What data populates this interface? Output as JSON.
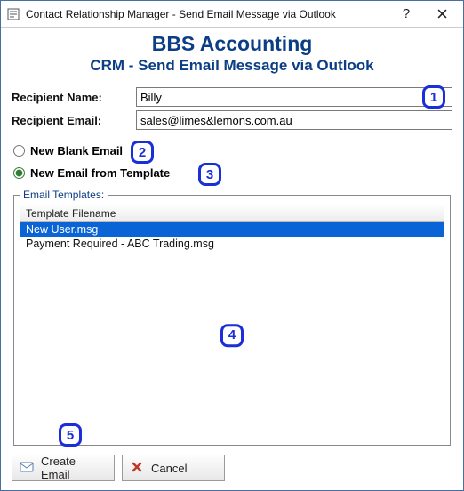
{
  "window": {
    "title": "Contact Relationship Manager - Send Email Message via Outlook"
  },
  "brand": {
    "title": "BBS Accounting",
    "subtitle": "CRM - Send Email Message via Outlook"
  },
  "form": {
    "recipient_name_label": "Recipient Name:",
    "recipient_name_value": "Billy",
    "recipient_email_label": "Recipient Email:",
    "recipient_email_value": "sales@limes&lemons.com.au"
  },
  "options": {
    "blank_label": "New Blank Email",
    "template_label": "New Email from Template",
    "selected": "template"
  },
  "templates": {
    "legend": "Email Templates:",
    "header": "Template Filename",
    "rows": [
      {
        "filename": "New User.msg",
        "selected": true
      },
      {
        "filename": "Payment Required - ABC Trading.msg",
        "selected": false
      }
    ]
  },
  "buttons": {
    "create": "Create Email",
    "cancel": "Cancel"
  },
  "callouts": {
    "c1": "1",
    "c2": "2",
    "c3": "3",
    "c4": "4",
    "c5": "5"
  }
}
